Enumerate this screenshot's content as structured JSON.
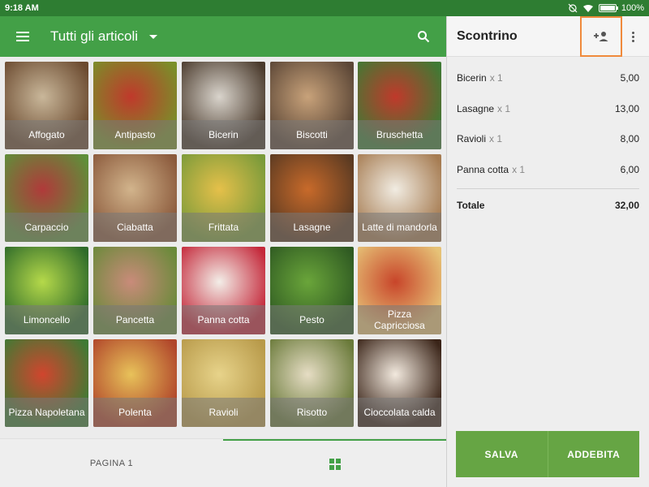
{
  "status_bar": {
    "time": "9:18 AM",
    "battery": "100%",
    "battery_level": 1.0
  },
  "toolbar": {
    "title": "Tutti gli articoli"
  },
  "items": [
    {
      "label": "Affogato",
      "color_a": "#c9b79a",
      "color_b": "#6b4a2f"
    },
    {
      "label": "Antipasto",
      "color_a": "#c0392b",
      "color_b": "#7a8f2a"
    },
    {
      "label": "Bicerin",
      "color_a": "#d9d4cc",
      "color_b": "#4a3a2c"
    },
    {
      "label": "Biscotti",
      "color_a": "#c8a27a",
      "color_b": "#5b4636"
    },
    {
      "label": "Bruschetta",
      "color_a": "#c0392b",
      "color_b": "#3f7a34"
    },
    {
      "label": "Carpaccio",
      "color_a": "#b03a3a",
      "color_b": "#5f8f3a"
    },
    {
      "label": "Ciabatta",
      "color_a": "#d2b48c",
      "color_b": "#8b5a3c"
    },
    {
      "label": "Frittata",
      "color_a": "#e5c04a",
      "color_b": "#7a9a3a"
    },
    {
      "label": "Lasagne",
      "color_a": "#c86a2a",
      "color_b": "#5a3a22"
    },
    {
      "label": "Latte di mandorla",
      "color_a": "#f1ece2",
      "color_b": "#a67c52"
    },
    {
      "label": "Limoncello",
      "color_a": "#b5d94a",
      "color_b": "#2f6b2a"
    },
    {
      "label": "Pancetta",
      "color_a": "#c98b7a",
      "color_b": "#6a8a3a"
    },
    {
      "label": "Panna cotta",
      "color_a": "#f3eee8",
      "color_b": "#c4283a"
    },
    {
      "label": "Pesto",
      "color_a": "#6aa53a",
      "color_b": "#2f5a22"
    },
    {
      "label": "Pizza Capricciosa",
      "color_a": "#c8452a",
      "color_b": "#e6c277"
    },
    {
      "label": "Pizza Napoletana",
      "color_a": "#d1452e",
      "color_b": "#3f7a34"
    },
    {
      "label": "Polenta",
      "color_a": "#e8c25a",
      "color_b": "#b0452a"
    },
    {
      "label": "Ravioli",
      "color_a": "#e7d38a",
      "color_b": "#b89a4a"
    },
    {
      "label": "Risotto",
      "color_a": "#e6ddc4",
      "color_b": "#6a7a3a"
    },
    {
      "label": "Cioccolata calda",
      "color_a": "#f2e9de",
      "color_b": "#3a2418"
    }
  ],
  "bottom_bar": {
    "page_label": "PAGINA 1"
  },
  "receipt": {
    "title": "Scontrino",
    "lines": [
      {
        "name": "Bicerin",
        "qty": "x 1",
        "price": "5,00"
      },
      {
        "name": "Lasagne",
        "qty": "x 1",
        "price": "13,00"
      },
      {
        "name": "Ravioli",
        "qty": "x 1",
        "price": "8,00"
      },
      {
        "name": "Panna cotta",
        "qty": "x 1",
        "price": "6,00"
      }
    ],
    "total_label": "Totale",
    "total_value": "32,00",
    "save_label": "SALVA",
    "charge_label": "ADDEBITA"
  },
  "colors": {
    "accent": "#43a047",
    "status": "#2e7d32",
    "button": "#66a544",
    "highlight": "#f08a3c"
  }
}
